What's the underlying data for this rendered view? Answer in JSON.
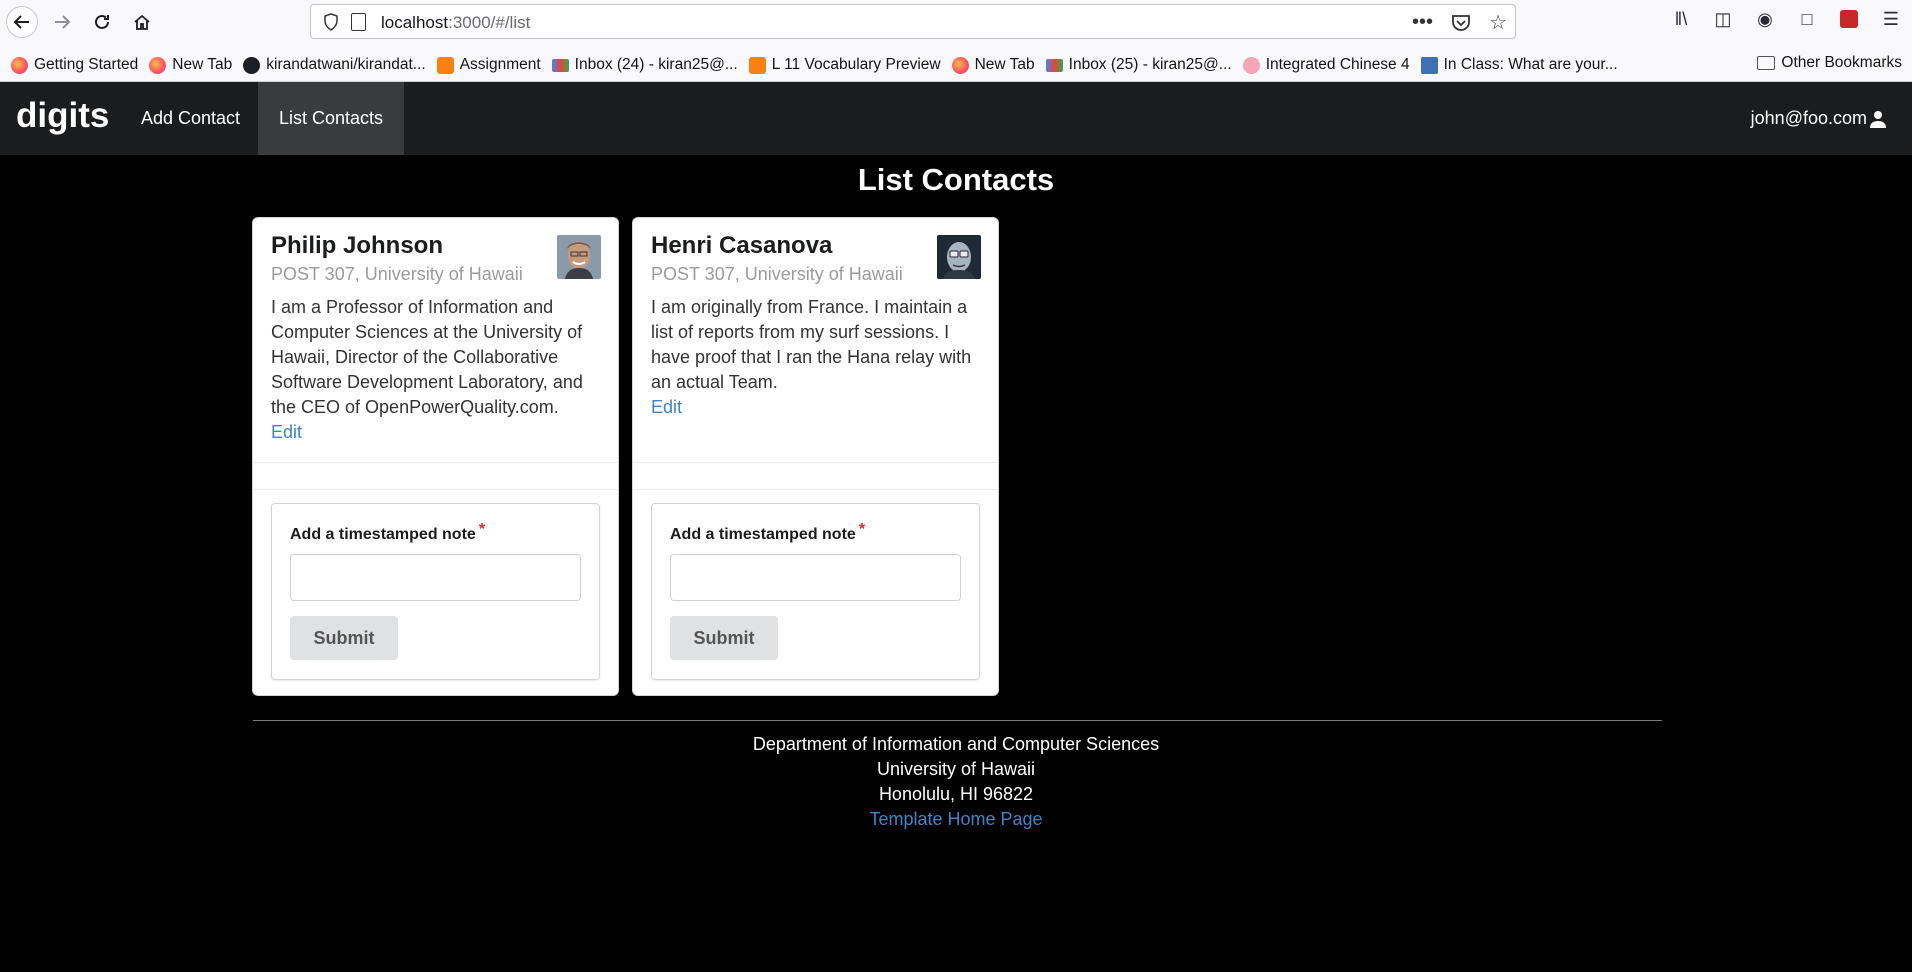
{
  "browser": {
    "url_host": "localhost",
    "url_rest": ":3000/#/list",
    "bookmarks": [
      {
        "label": "Getting Started",
        "icon": "firefox-icon"
      },
      {
        "label": "New Tab",
        "icon": "firefox-icon"
      },
      {
        "label": "kirandatwani/kirandat...",
        "icon": "github-icon"
      },
      {
        "label": "Assignment",
        "icon": "moodle-icon"
      },
      {
        "label": "Inbox (24) - kiran25@...",
        "icon": "gmail-icon"
      },
      {
        "label": "L 11 Vocabulary Preview",
        "icon": "moodle-icon"
      },
      {
        "label": "New Tab",
        "icon": "firefox-icon"
      },
      {
        "label": "Inbox (25) - kiran25@...",
        "icon": "gmail-icon"
      },
      {
        "label": "Integrated Chinese 4",
        "icon": "brain-icon"
      },
      {
        "label": "In Class: What are your...",
        "icon": "doc-icon"
      }
    ],
    "other_bookmarks": "Other Bookmarks"
  },
  "navbar": {
    "brand": "digits",
    "items": [
      {
        "label": "Add Contact"
      },
      {
        "label": "List Contacts"
      }
    ],
    "user": "john@foo.com"
  },
  "page": {
    "title": "List Contacts"
  },
  "contacts": [
    {
      "name": "Philip Johnson",
      "address": "POST 307, University of Hawaii",
      "description": "I am a Professor of Information and Computer Sciences at the University of Hawaii, Director of the Collaborative Software Development Laboratory, and the CEO of OpenPowerQuality.com.",
      "edit": "Edit",
      "note_label": "Add a timestamped note",
      "submit": "Submit"
    },
    {
      "name": "Henri Casanova",
      "address": "POST 307, University of Hawaii",
      "description": "I am originally from France. I maintain a list of reports from my surf sessions. I have proof that I ran the Hana relay with an actual Team.",
      "edit": "Edit",
      "note_label": "Add a timestamped note",
      "submit": "Submit"
    }
  ],
  "footer": {
    "line1": "Department of Information and Computer Sciences",
    "line2": "University of Hawaii",
    "line3": "Honolulu, HI 96822",
    "link": "Template Home Page"
  }
}
